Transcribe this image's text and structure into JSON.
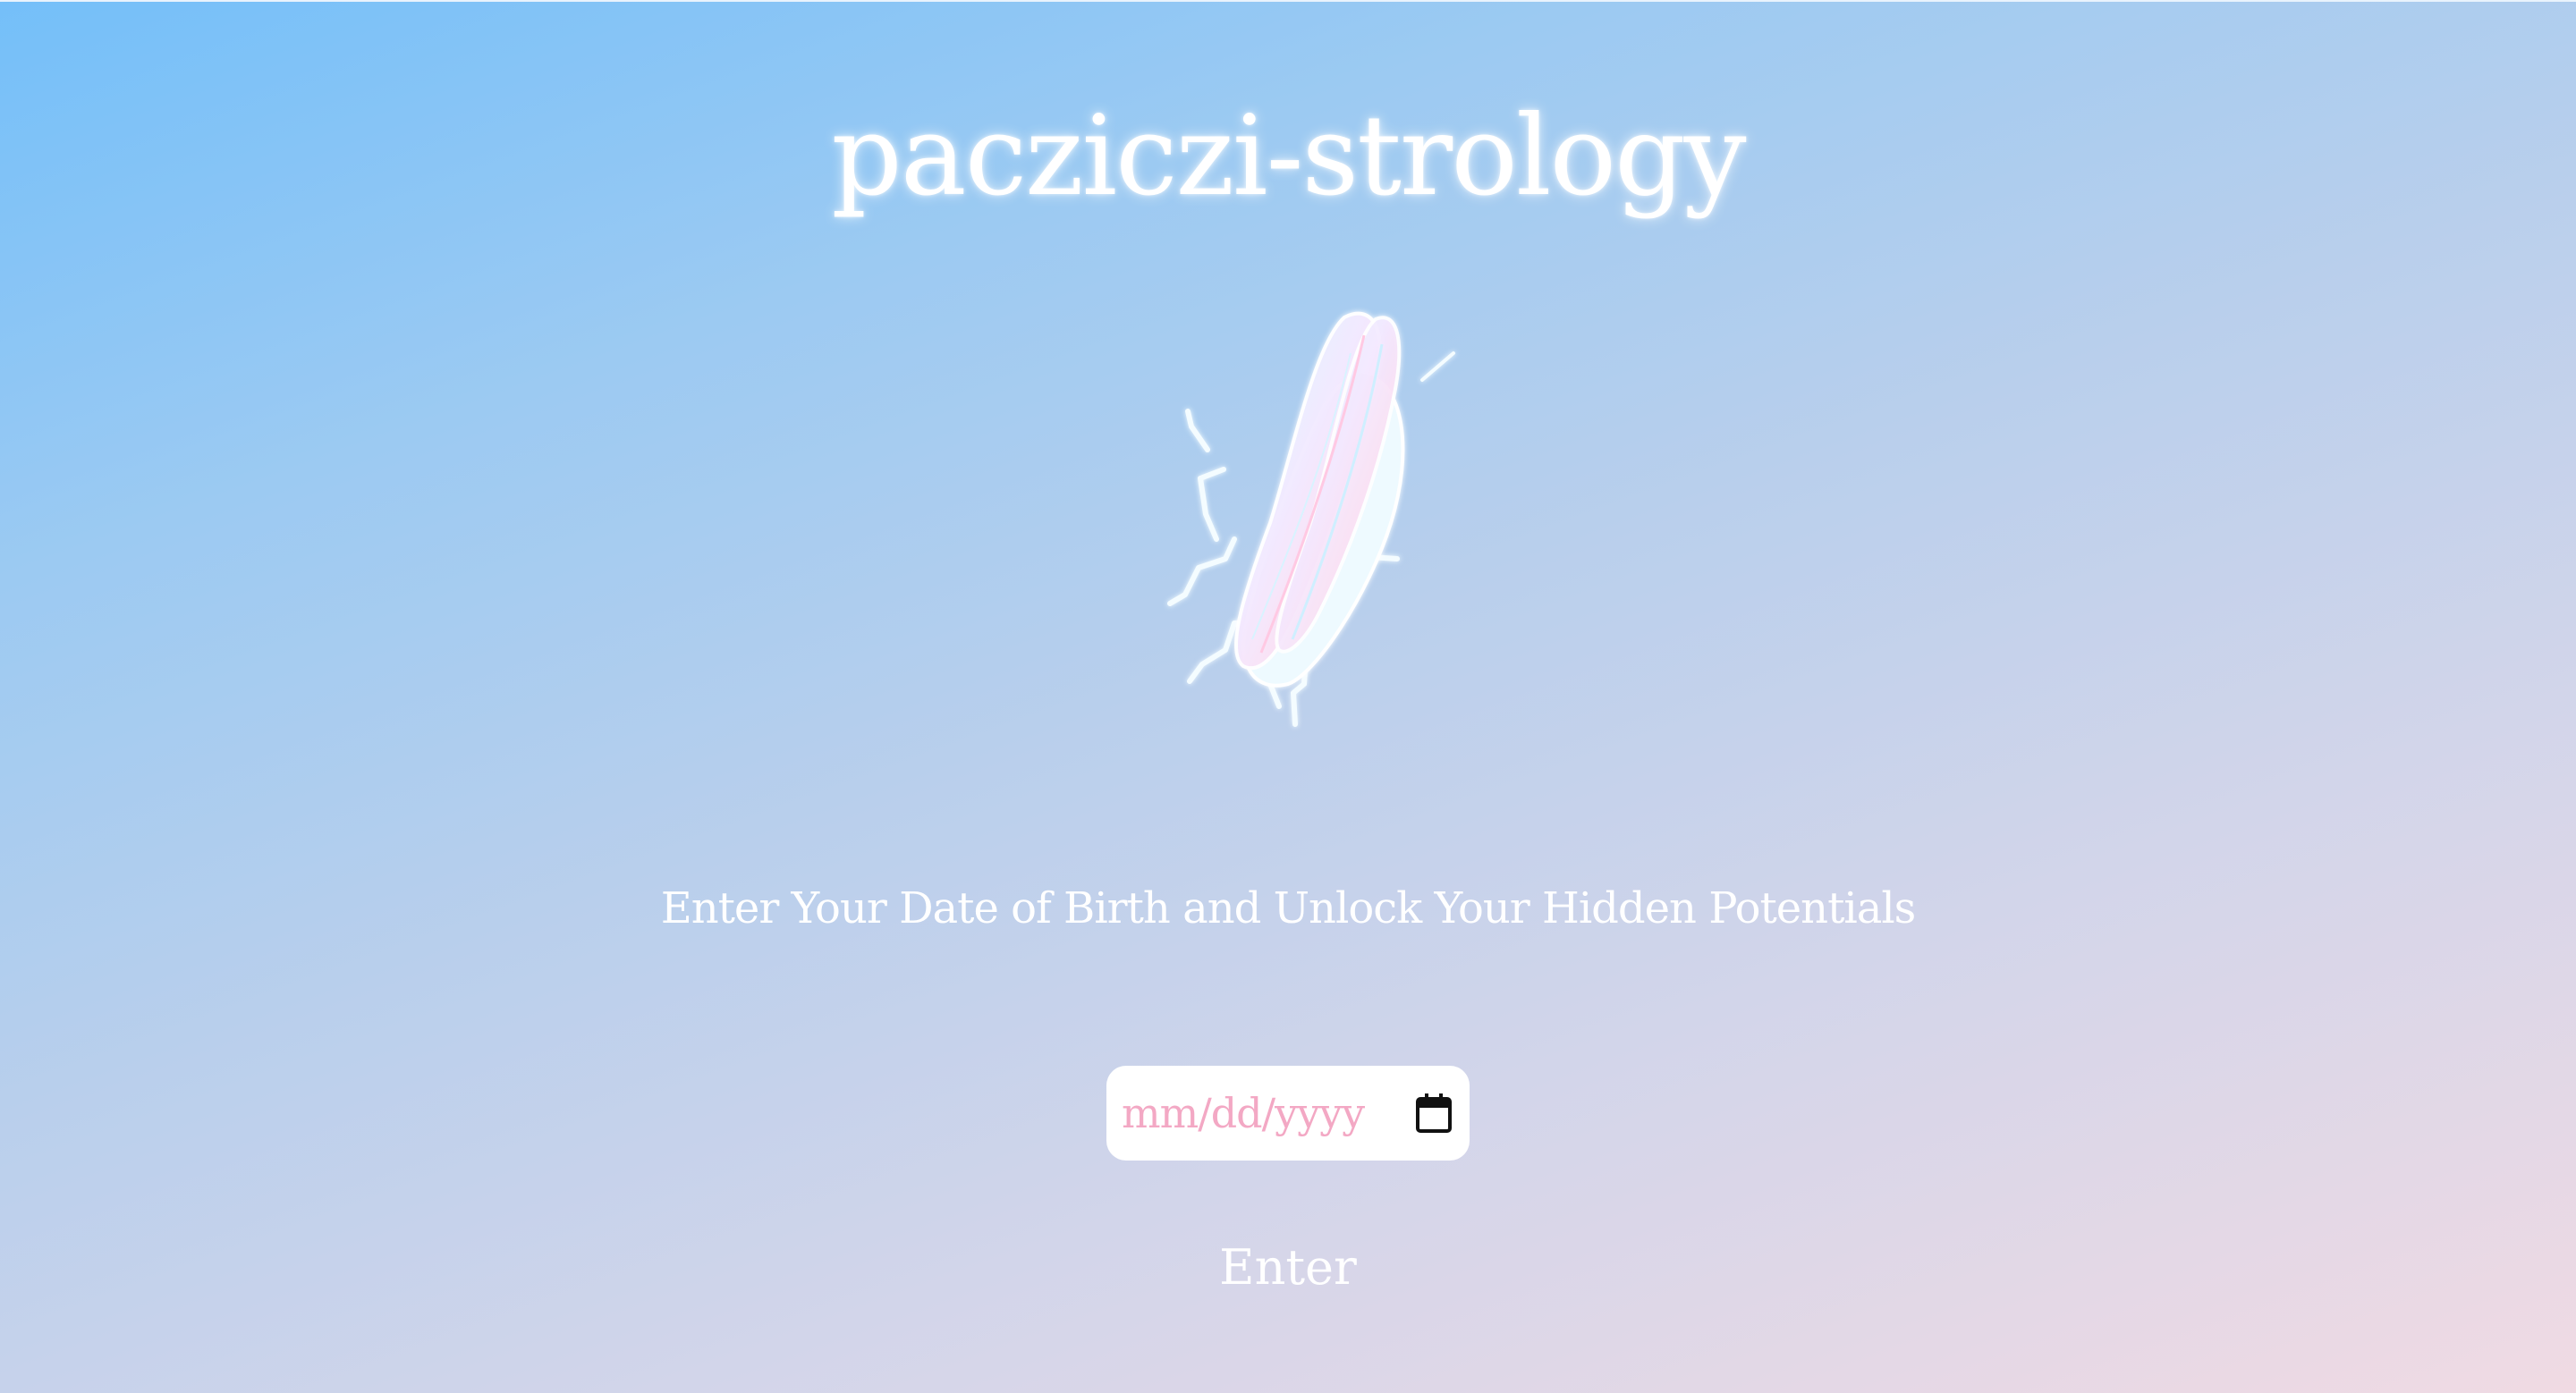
{
  "page": {
    "title": "pacziczi-strology",
    "image": {
      "icon": "leafhopper-insect-illustration"
    },
    "tagline": "Enter Your Date of Birth and Unlock Your Hidden Potentials",
    "birthdate_input": {
      "value": "",
      "placeholder": "mm/dd/yyyy",
      "icon": "calendar-icon"
    },
    "submit_label": "Enter"
  },
  "colors": {
    "gradient_start": "#74bff9",
    "gradient_end": "#f0dae3",
    "placeholder_text": "#f3a8c4",
    "text": "#ffffff"
  }
}
